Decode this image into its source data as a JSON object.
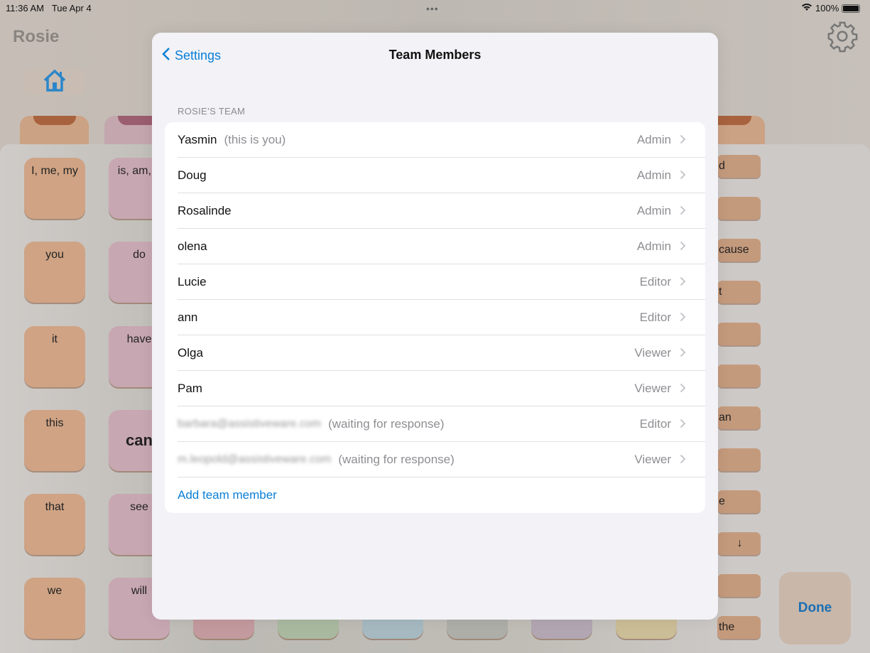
{
  "status_bar": {
    "time": "11:36 AM",
    "date": "Tue Apr 4",
    "battery": "100%"
  },
  "app": {
    "title": "Rosie",
    "done_label": "Done"
  },
  "vocab": {
    "col1": [
      "I, me, my",
      "you",
      "it",
      "this",
      "that",
      "we"
    ],
    "col2": [
      "is, am, a",
      "do",
      "have",
      "can",
      "see",
      "will"
    ],
    "right": [
      "d",
      "",
      "cause",
      "t",
      "",
      "",
      "an",
      "",
      "e",
      "↓",
      "",
      "the"
    ]
  },
  "modal": {
    "back_label": "Settings",
    "title": "Team Members",
    "section_header": "ROSIE’S TEAM",
    "members": [
      {
        "name": "Yasmin",
        "note": "(this is you)",
        "role": "Admin"
      },
      {
        "name": "Doug",
        "note": "",
        "role": "Admin"
      },
      {
        "name": "Rosalinde",
        "note": "",
        "role": "Admin"
      },
      {
        "name": "olena",
        "note": "",
        "role": "Admin"
      },
      {
        "name": "Lucie",
        "note": "",
        "role": "Editor"
      },
      {
        "name": "ann",
        "note": "",
        "role": "Editor"
      },
      {
        "name": "Olga",
        "note": "",
        "role": "Viewer"
      },
      {
        "name": "Pam",
        "note": "",
        "role": "Viewer"
      }
    ],
    "pending": [
      {
        "email": "barbara@assistiveware.com",
        "note": "(waiting for response)",
        "role": "Editor"
      },
      {
        "email": "m.leopold@assistiveware.com",
        "note": "(waiting for response)",
        "role": "Viewer"
      }
    ],
    "add_label": "Add team member"
  },
  "colors": {
    "accent": "#0a7fd6",
    "modal_bg": "#f2f2f7"
  }
}
